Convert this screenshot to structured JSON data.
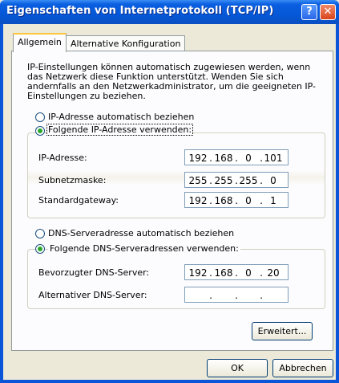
{
  "window": {
    "title": "Eigenschaften von Internetprotokoll (TCP/IP)",
    "help_glyph": "?",
    "close_glyph": "✕"
  },
  "tabs": [
    {
      "label": "Allgemein",
      "active": true
    },
    {
      "label": "Alternative Konfiguration",
      "active": false
    }
  ],
  "description": "IP-Einstellungen können automatisch zugewiesen werden, wenn das Netzwerk diese Funktion unterstützt. Wenden Sie sich andernfalls an den Netzwerkadministrator, um die geeigneten IP-Einstellungen zu beziehen.",
  "ip_mode": {
    "auto_label": "IP-Adresse automatisch beziehen",
    "manual_label": "Folgende IP-Adresse verwenden:",
    "selected": "manual"
  },
  "ip_fields": [
    {
      "label": "IP-Adresse:",
      "value": [
        "192",
        "168",
        "0",
        "101"
      ]
    },
    {
      "label": "Subnetzmaske:",
      "value": [
        "255",
        "255",
        "255",
        "0"
      ]
    },
    {
      "label": "Standardgateway:",
      "value": [
        "192",
        "168",
        "0",
        "1"
      ]
    }
  ],
  "dns_mode": {
    "auto_label": "DNS-Serveradresse automatisch beziehen",
    "manual_label": "Folgende DNS-Serveradressen verwenden:",
    "selected": "manual"
  },
  "dns_fields": [
    {
      "label": "Bevorzugter DNS-Server:",
      "value": [
        "192",
        "168",
        "0",
        "20"
      ]
    },
    {
      "label": "Alternativer DNS-Server:",
      "value": [
        "",
        "",
        "",
        ""
      ]
    }
  ],
  "buttons": {
    "advanced": "Erweitert...",
    "ok": "OK",
    "cancel": "Abbrechen"
  },
  "ip_dot": ".",
  "colors": {
    "titlebar": "#0458d8",
    "dialog_bg": "#ece9d8",
    "panel_bg": "#fcfcfe",
    "radio_dot": "#2ba82b",
    "field_border": "#7f9db9",
    "active_tab_accent": "#ffc83c"
  }
}
